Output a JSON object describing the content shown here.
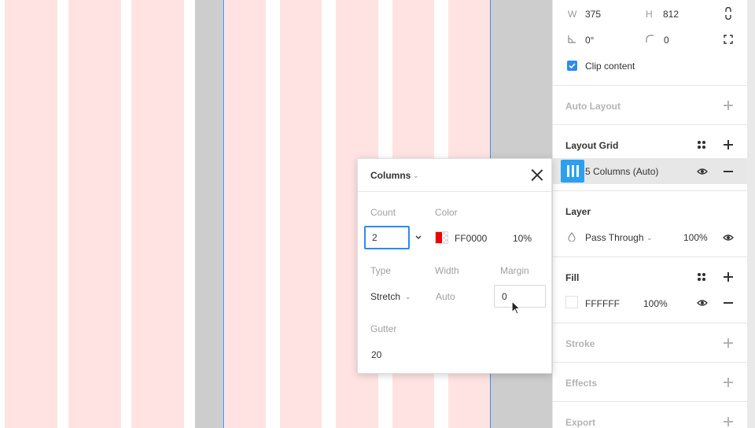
{
  "panel": {
    "dimensions": {
      "w_label": "W",
      "w_value": "375",
      "h_label": "H",
      "h_value": "812"
    },
    "rotation_value": "0°",
    "radius_value": "0",
    "clip_content_label": "Clip content",
    "auto_layout_title": "Auto Layout",
    "layout_grid": {
      "title": "Layout Grid",
      "item_label": "5 Columns (Auto)"
    },
    "layer": {
      "title": "Layer",
      "blend_mode": "Pass Through",
      "opacity": "100%"
    },
    "fill": {
      "title": "Fill",
      "hex": "FFFFFF",
      "opacity": "100%"
    },
    "stroke_title": "Stroke",
    "effects_title": "Effects",
    "export_title": "Export"
  },
  "popup": {
    "title": "Columns",
    "count_label": "Count",
    "count_value": "2",
    "color_label": "Color",
    "color_hex": "FF0000",
    "color_opacity": "10%",
    "type_label": "Type",
    "type_value": "Stretch",
    "width_label": "Width",
    "width_value": "Auto",
    "margin_label": "Margin",
    "margin_value": "0",
    "gutter_label": "Gutter",
    "gutter_value": "20"
  },
  "colors": {
    "accent": "#2c8cf0",
    "grid_column": "#ffe3e3",
    "grid_color": "#ff0000"
  },
  "icons": [
    "link-proportions-icon",
    "rotation-icon",
    "corner-radius-icon",
    "independent-corners-icon",
    "checkbox-checked-icon",
    "plus-icon",
    "style-dots-icon",
    "layout-grid-columns-icon",
    "eye-icon",
    "minus-icon",
    "blend-mode-drop-icon",
    "chevron-down-icon",
    "close-icon",
    "pointer-cursor-icon"
  ]
}
